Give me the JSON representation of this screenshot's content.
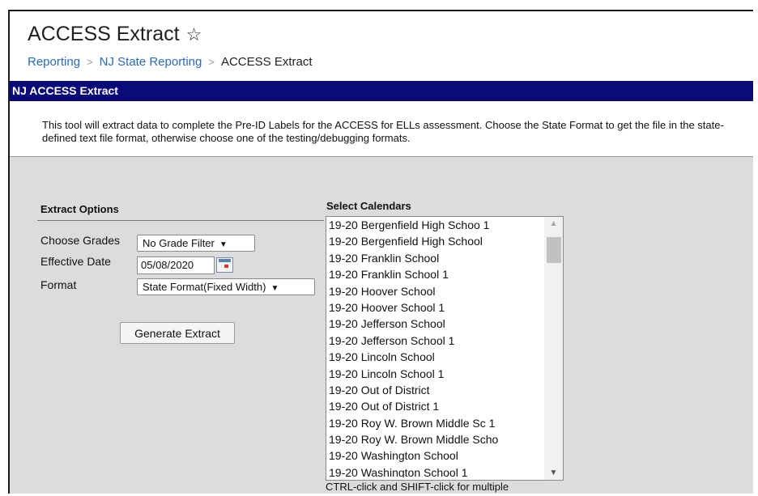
{
  "page": {
    "title": "ACCESS Extract",
    "breadcrumb": [
      "Reporting",
      "NJ State Reporting",
      "ACCESS Extract"
    ]
  },
  "section": {
    "title": "NJ ACCESS Extract",
    "description": "This tool will extract data to complete the Pre-ID Labels for the ACCESS for ELLs assessment. Choose the State Format to get the file in the state-defined text file format, otherwise choose one of the testing/debugging formats."
  },
  "extract_options": {
    "title": "Extract Options",
    "grades_label": "Choose Grades",
    "grades_value": "No Grade Filter",
    "date_label": "Effective Date",
    "date_value": "05/08/2020",
    "format_label": "Format",
    "format_value": "State Format(Fixed Width)",
    "generate_label": "Generate Extract"
  },
  "calendars": {
    "title": "Select Calendars",
    "items": [
      "19-20 Bergenfield High Schoo 1",
      "19-20 Bergenfield High School",
      "19-20 Franklin School",
      "19-20 Franklin School 1",
      "19-20 Hoover School",
      "19-20 Hoover School 1",
      "19-20 Jefferson School",
      "19-20 Jefferson School 1",
      "19-20 Lincoln School",
      "19-20 Lincoln School 1",
      "19-20 Out of District",
      "19-20 Out of District 1",
      "19-20 Roy W. Brown Middle Sc 1",
      "19-20 Roy W. Brown Middle Scho",
      "19-20 Washington School",
      "19-20 Washington School 1"
    ],
    "hint": "CTRL-click and SHIFT-click for multiple"
  },
  "icons": {
    "favorite": "star-outline-icon",
    "date_picker": "calendar-icon",
    "dropdown": "caret-down-icon"
  },
  "colors": {
    "section_bar": "#0a0a78",
    "link": "#2a6bb8",
    "panel_bg": "#dcdcdc"
  }
}
